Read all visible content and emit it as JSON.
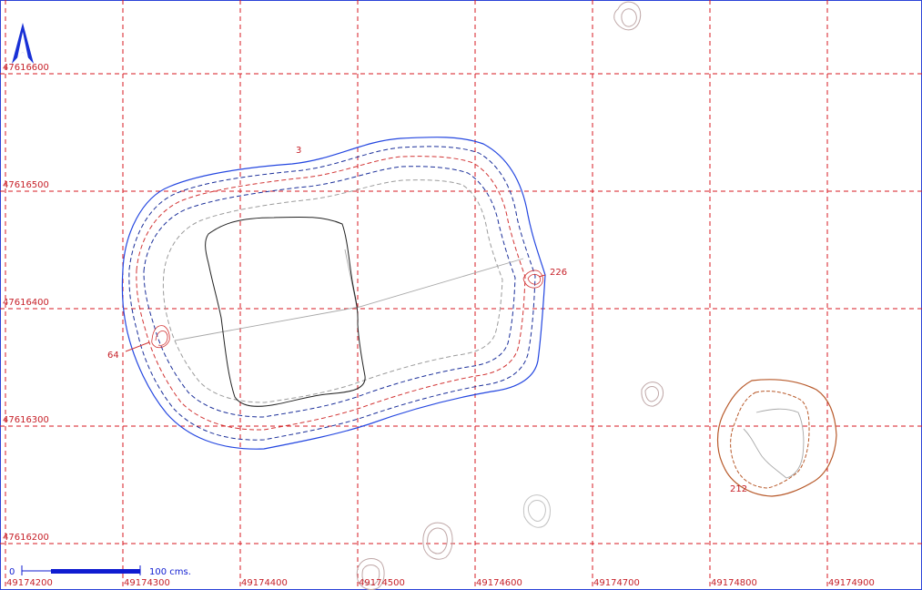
{
  "map": {
    "background_color": "#ffffff",
    "frame_color": "#2b43d8",
    "grid_color": "#d71920",
    "y_labels": [
      "47616600",
      "47616500",
      "47616400",
      "47616300",
      "47616200"
    ],
    "x_labels": [
      "49174200",
      "49174300",
      "49174400",
      "49174500",
      "49174600",
      "49174700",
      "49174800",
      "49174900"
    ],
    "feature_labels": {
      "label_3": "3",
      "label_226": "226",
      "label_64": "64",
      "label_212": "212"
    },
    "north_arrow": "north-arrow",
    "scale_bar": {
      "left_label": "0",
      "right_label": "100 cms.",
      "color": "#0f1cd1"
    },
    "feature_colors": {
      "outer": "#2346e0",
      "inner": "#d23434",
      "brown": "#b85a2b",
      "gray": "#9c9c9c",
      "black": "#222222"
    }
  }
}
